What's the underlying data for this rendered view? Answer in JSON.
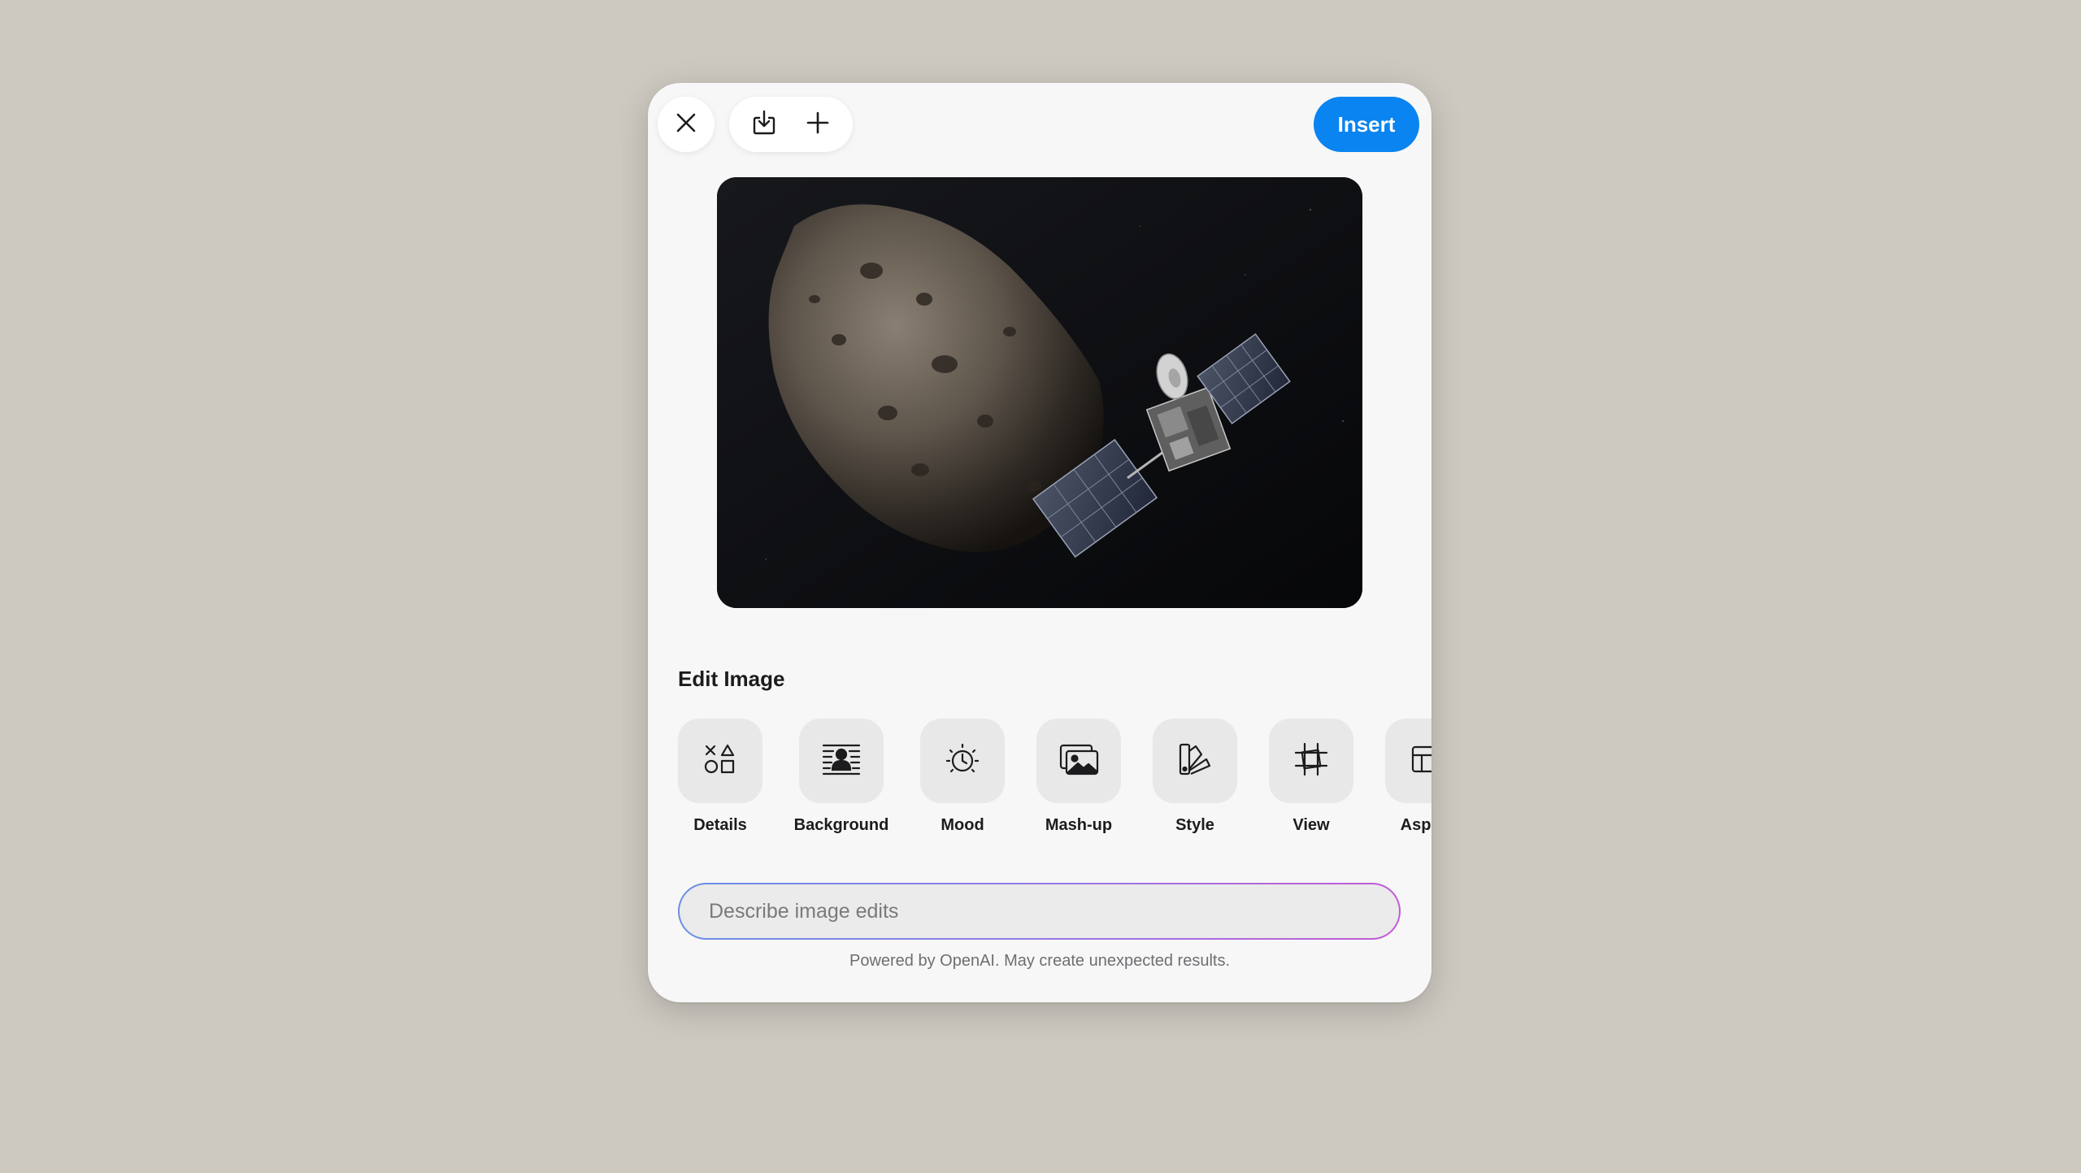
{
  "toolbar": {
    "close_icon": "close-icon",
    "download_icon": "download-icon",
    "add_icon": "plus-icon",
    "insert_label": "Insert",
    "accent_color": "#0a84f0"
  },
  "preview": {
    "description_icon": "image-preview"
  },
  "edit_section": {
    "title": "Edit Image",
    "options": [
      {
        "label": "Details",
        "icon": "shapes-icon"
      },
      {
        "label": "Background",
        "icon": "background-icon"
      },
      {
        "label": "Mood",
        "icon": "mood-icon"
      },
      {
        "label": "Mash-up",
        "icon": "mashup-icon"
      },
      {
        "label": "Style",
        "icon": "style-icon"
      },
      {
        "label": "View",
        "icon": "view-icon"
      },
      {
        "label": "Aspect",
        "icon": "aspect-icon"
      }
    ]
  },
  "prompt": {
    "placeholder": "Describe image edits",
    "value": ""
  },
  "footer": {
    "note": "Powered by OpenAI. May create unexpected results."
  }
}
